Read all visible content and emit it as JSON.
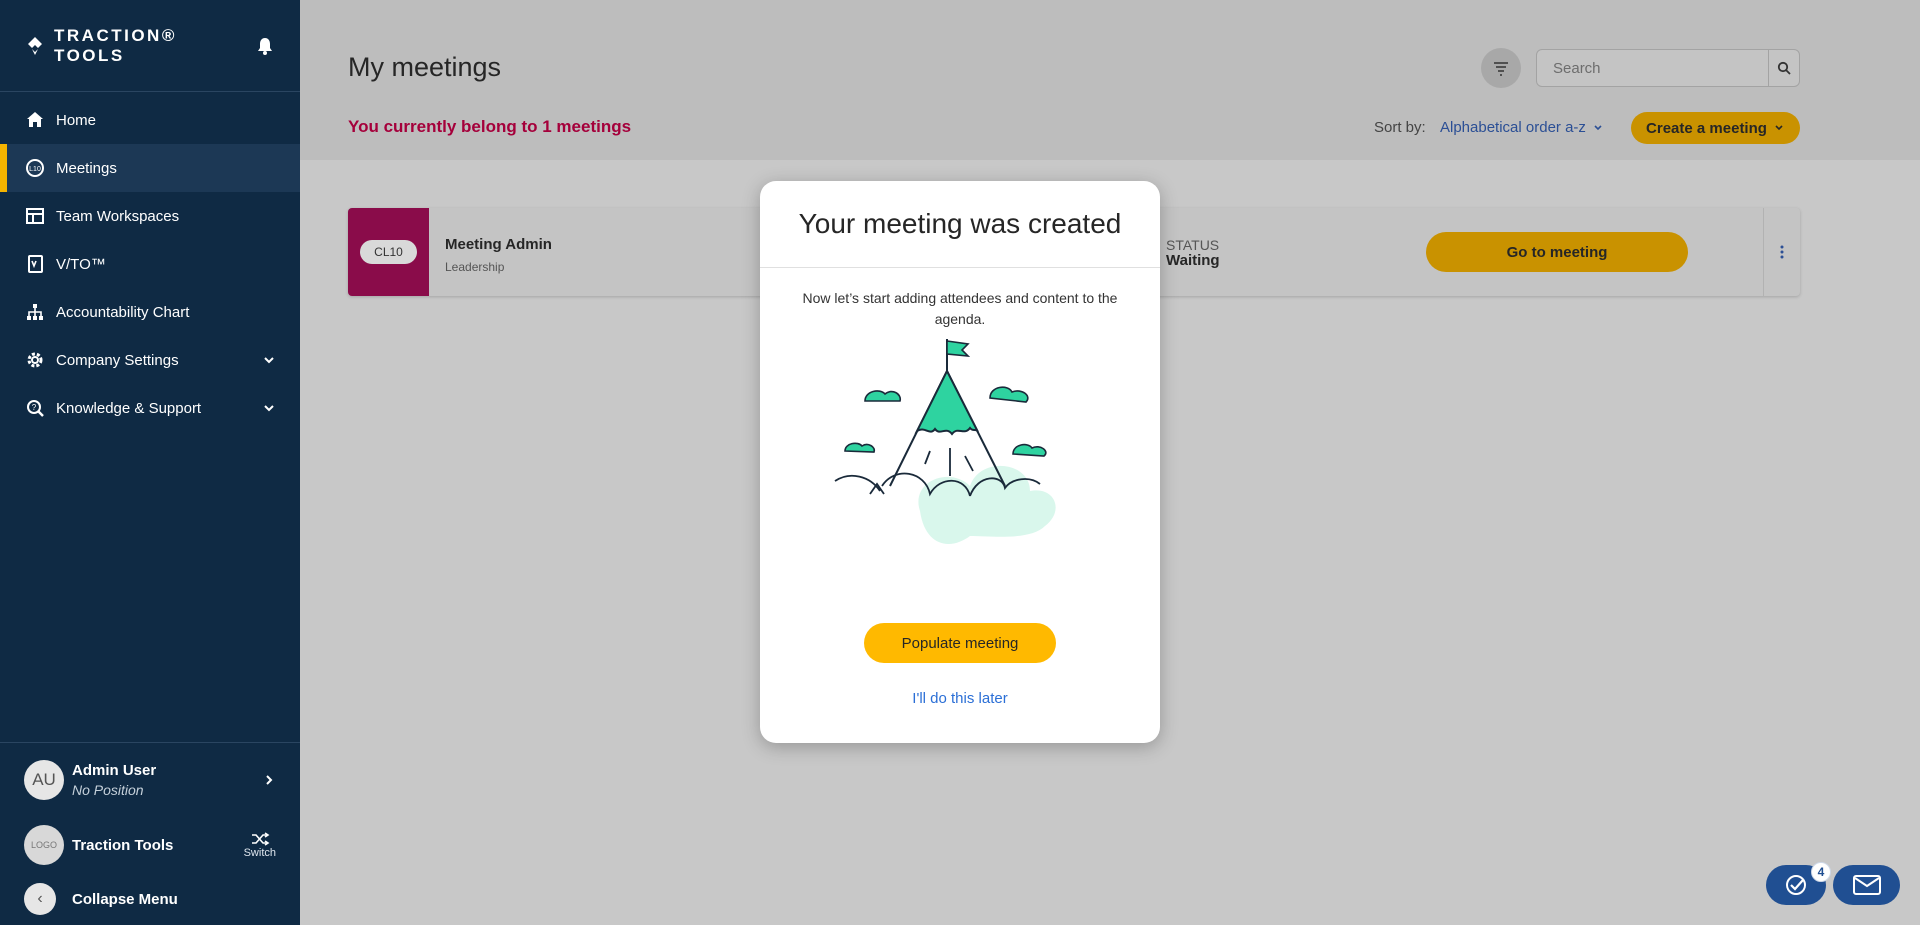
{
  "sidebar": {
    "brand": "TRACTION® TOOLS",
    "items": [
      {
        "label": "Home",
        "icon": "home-icon"
      },
      {
        "label": "Meetings",
        "icon": "meetings-icon",
        "active": true
      },
      {
        "label": "Team Workspaces",
        "icon": "workspace-icon"
      },
      {
        "label": "V/TO™",
        "icon": "vto-icon"
      },
      {
        "label": "Accountability Chart",
        "icon": "org-chart-icon"
      },
      {
        "label": "Company Settings",
        "icon": "gear-icon",
        "expandable": true
      },
      {
        "label": "Knowledge & Support",
        "icon": "support-icon",
        "expandable": true
      }
    ],
    "user": {
      "initials": "AU",
      "name": "Admin User",
      "position": "No Position"
    },
    "org": {
      "logo": "LOGO",
      "name": "Traction Tools",
      "switch_label": "Switch"
    },
    "collapse_label": "Collapse Menu"
  },
  "header": {
    "title": "My meetings",
    "belong_text": "You currently belong to 1 meetings",
    "search_placeholder": "Search",
    "sort_label": "Sort by:",
    "sort_value": "Alphabetical order a-z",
    "create_label": "Create a meeting"
  },
  "meeting": {
    "tag": "CL10",
    "title": "Meeting Admin",
    "subtitle": "Leadership",
    "status_label": "STATUS",
    "status_value": "Waiting",
    "go_label": "Go to meeting"
  },
  "modal": {
    "title": "Your meeting was created",
    "description": "Now let’s start adding attendees and content to the agenda.",
    "primary_label": "Populate meeting",
    "secondary_label": "I'll do this later"
  },
  "fab": {
    "tasks_badge": "4"
  },
  "colors": {
    "sidebar_bg": "#0f2a44",
    "accent": "#ffb900",
    "belong_text": "#a5003b",
    "link": "#2b6fd6",
    "mountain": "#2ed3a0"
  }
}
